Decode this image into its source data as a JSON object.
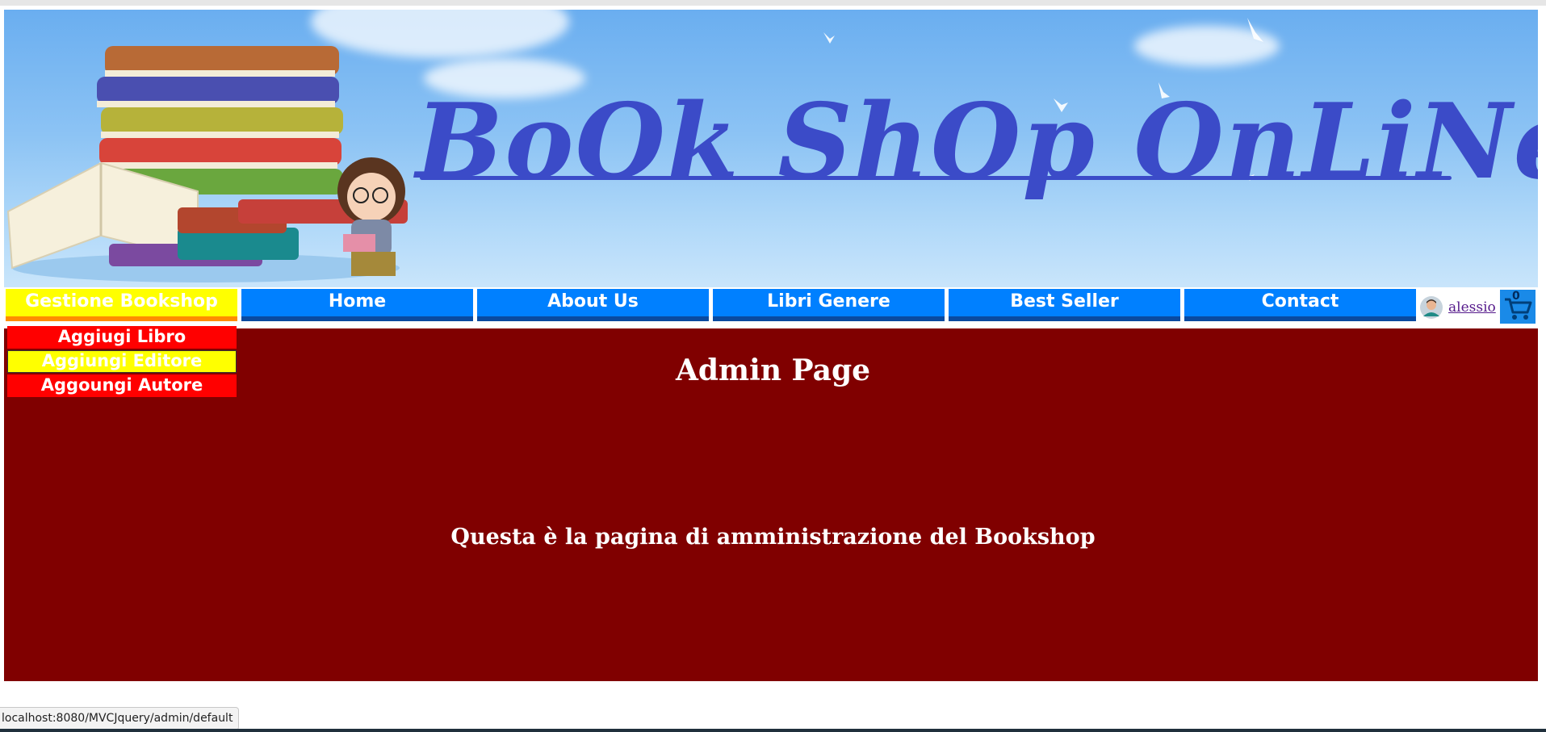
{
  "banner": {
    "brand_text": "BoOk ShOp OnLiNe"
  },
  "nav": {
    "items": [
      {
        "label": "Gestione Bookshop",
        "active": true
      },
      {
        "label": "Home"
      },
      {
        "label": "About Us"
      },
      {
        "label": "Libri Genere"
      },
      {
        "label": "Best Seller"
      },
      {
        "label": "Contact"
      }
    ],
    "dropdown": [
      {
        "label": "Aggiugi Libro"
      },
      {
        "label": "Aggiungi Editore"
      },
      {
        "label": "Aggoungi Autore"
      }
    ]
  },
  "user": {
    "name": "alessio",
    "cart_count": "0"
  },
  "content": {
    "title": "Admin Page",
    "description": "Questa è la pagina di amministrazione del Bookshop"
  },
  "status_bar": {
    "url": "localhost:8080/MVCJquery/admin/default"
  },
  "colors": {
    "nav_blue": "#0080ff",
    "nav_active": "#ffff00",
    "content_bg": "#800000",
    "brand": "#3b4bc8",
    "dropdown_red": "#ff0000"
  },
  "icons": [
    "user-avatar-icon",
    "shopping-cart-icon"
  ]
}
